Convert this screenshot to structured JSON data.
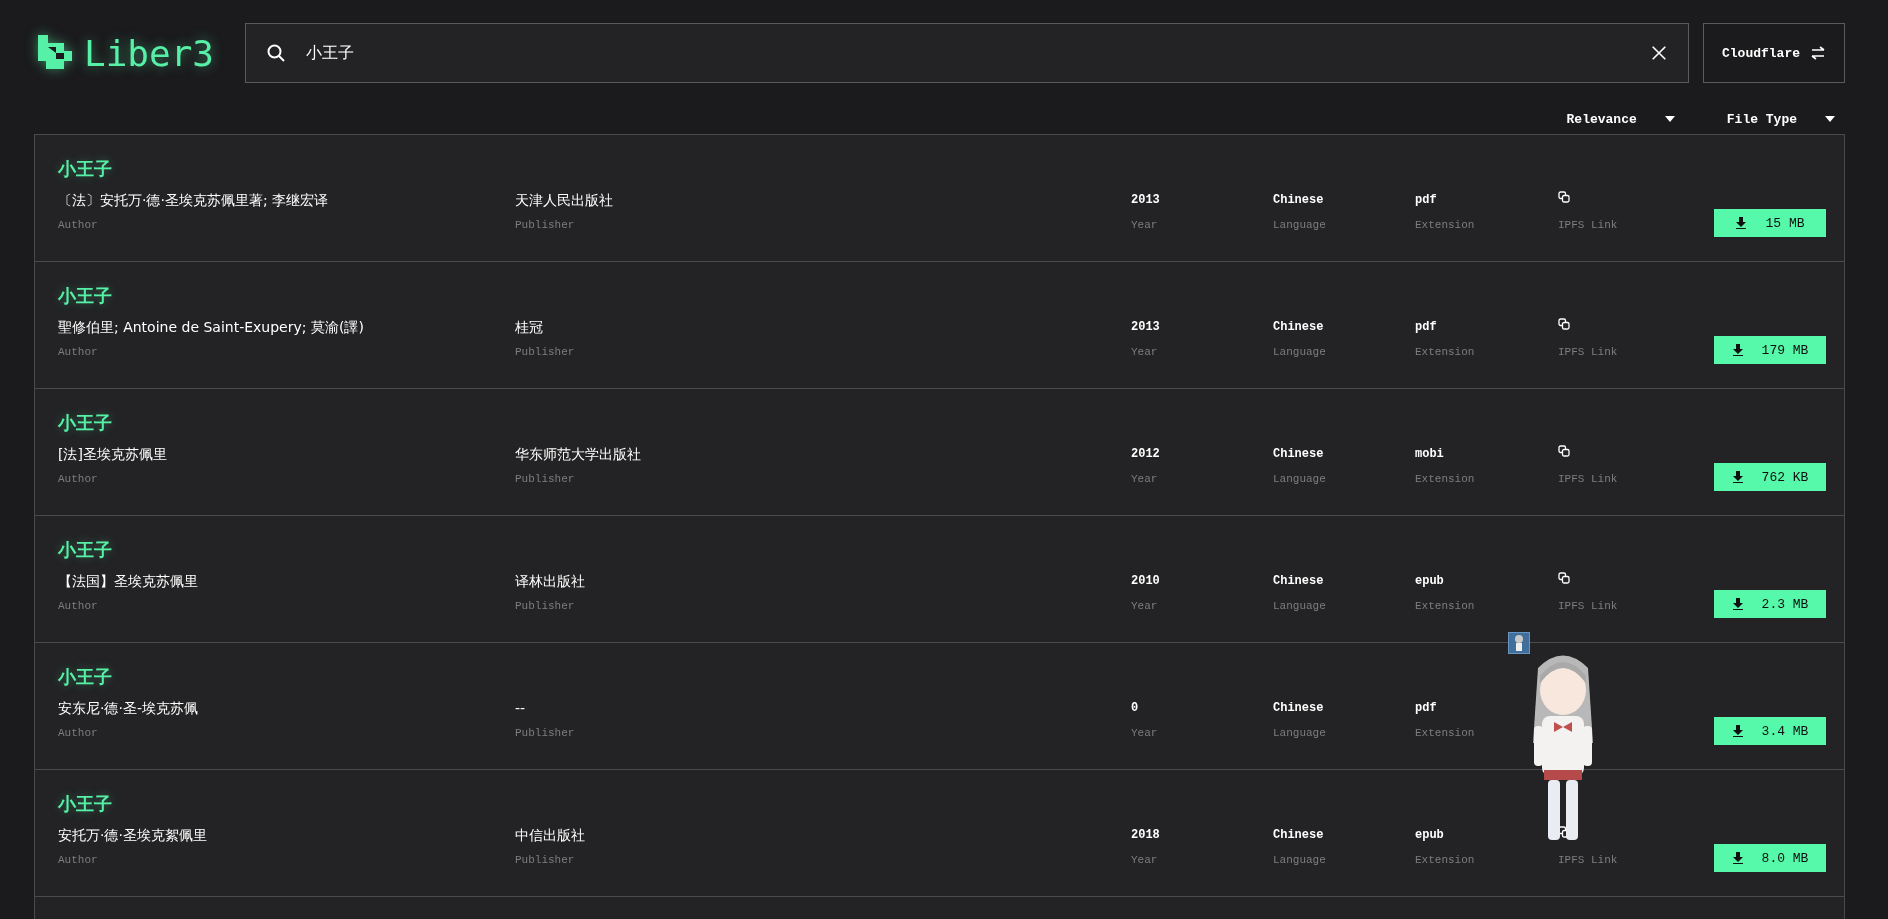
{
  "logo": {
    "text": "Liber3"
  },
  "search": {
    "value": "小王子"
  },
  "gateway_button": {
    "label": "Cloudflare"
  },
  "sort_controls": [
    {
      "label": "Relevance"
    },
    {
      "label": "File Type"
    }
  ],
  "results": [
    {
      "title": "小王子",
      "author": "〔法〕安托万·德·圣埃克苏佩里著; 李继宏译",
      "author_label": "Author",
      "publisher": "天津人民出版社",
      "publisher_label": "Publisher",
      "year": "2013",
      "year_label": "Year",
      "language": "Chinese",
      "language_label": "Language",
      "extension": "pdf",
      "extension_label": "Extension",
      "ipfs_label": "IPFS Link",
      "size": "15 MB"
    },
    {
      "title": "小王子",
      "author": "聖修伯里; Antoine de Saint-Exupery; 莫渝(譯)",
      "author_label": "Author",
      "publisher": "桂冠",
      "publisher_label": "Publisher",
      "year": "2013",
      "year_label": "Year",
      "language": "Chinese",
      "language_label": "Language",
      "extension": "pdf",
      "extension_label": "Extension",
      "ipfs_label": "IPFS Link",
      "size": "179 MB"
    },
    {
      "title": "小王子",
      "author": "[法]圣埃克苏佩里",
      "author_label": "Author",
      "publisher": "华东师范大学出版社",
      "publisher_label": "Publisher",
      "year": "2012",
      "year_label": "Year",
      "language": "Chinese",
      "language_label": "Language",
      "extension": "mobi",
      "extension_label": "Extension",
      "ipfs_label": "IPFS Link",
      "size": "762 KB"
    },
    {
      "title": "小王子",
      "author": "【法国】圣埃克苏佩里",
      "author_label": "Author",
      "publisher": "译林出版社",
      "publisher_label": "Publisher",
      "year": "2010",
      "year_label": "Year",
      "language": "Chinese",
      "language_label": "Language",
      "extension": "epub",
      "extension_label": "Extension",
      "ipfs_label": "IPFS Link",
      "size": "2.3 MB"
    },
    {
      "title": "小王子",
      "author": "安东尼·德·圣-埃克苏佩",
      "author_label": "Author",
      "publisher": "--",
      "publisher_label": "Publisher",
      "year": "0",
      "year_label": "Year",
      "language": "Chinese",
      "language_label": "Language",
      "extension": "pdf",
      "extension_label": "Extension",
      "size": "3.4 MB"
    },
    {
      "title": "小王子",
      "author": "安托万·德·圣埃克絮佩里",
      "author_label": "Author",
      "publisher": "中信出版社",
      "publisher_label": "Publisher",
      "year": "2018",
      "year_label": "Year",
      "language": "Chinese",
      "language_label": "Language",
      "extension": "epub",
      "extension_label": "Extension",
      "ipfs_label": "IPFS Link",
      "size": "8.0 MB"
    }
  ]
}
